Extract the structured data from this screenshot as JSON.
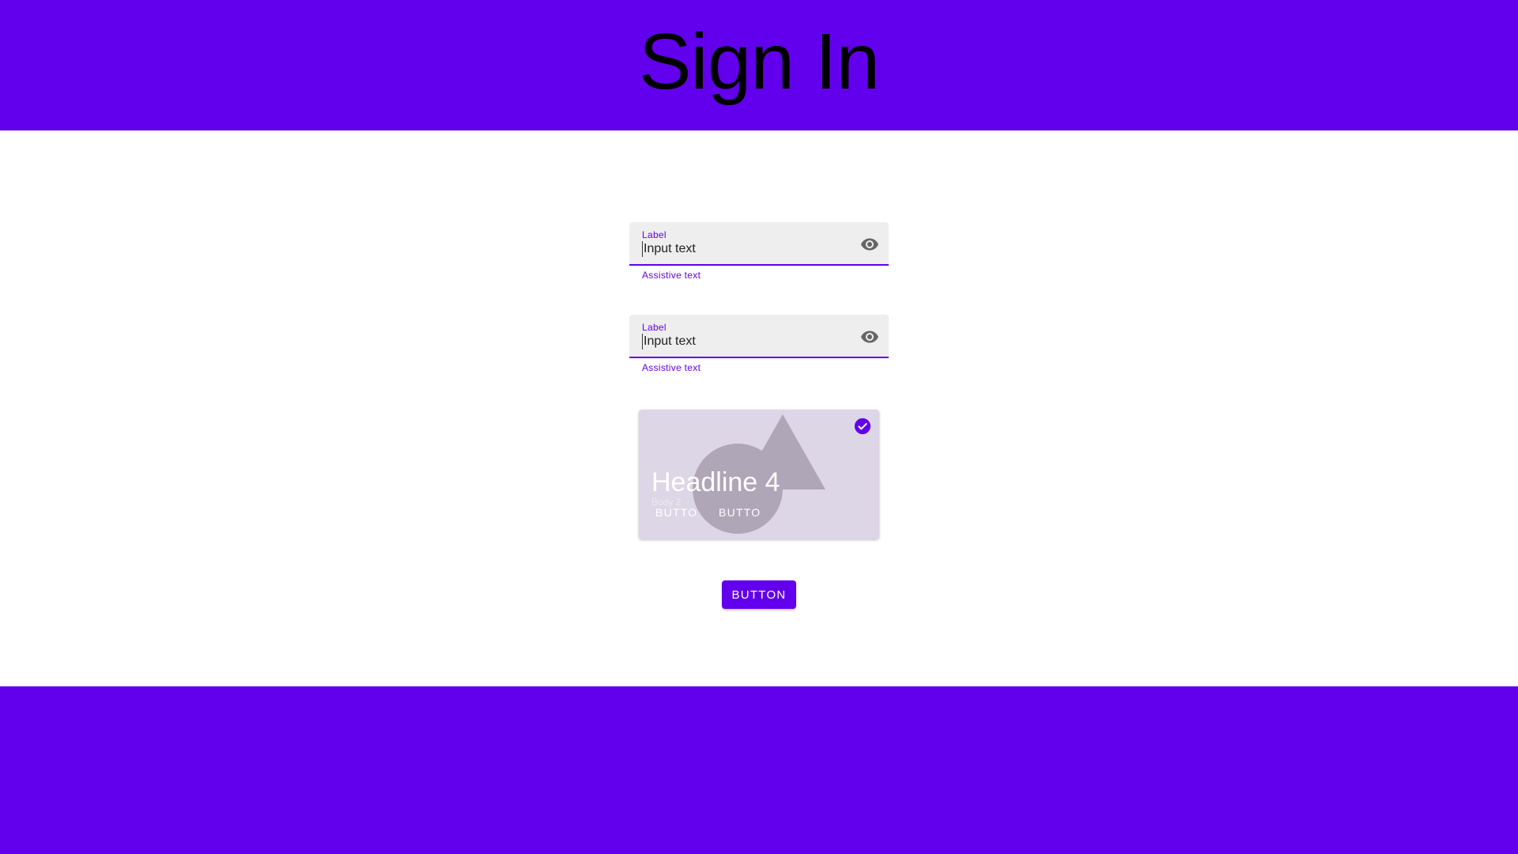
{
  "header": {
    "title": "Sign In"
  },
  "fields": [
    {
      "label": "Label",
      "value": "Input text",
      "assistive": "Assistive text",
      "icon": "eye-icon"
    },
    {
      "label": "Label",
      "value": "Input text",
      "assistive": "Assistive text",
      "icon": "eye-icon"
    }
  ],
  "card": {
    "headline": "Headline 4",
    "body": "Body 2",
    "button_1": "BUTTO",
    "button_2": "BUTTO",
    "selected": true,
    "icon": "check-circle-icon"
  },
  "primary_button": {
    "label": "BUTTON"
  },
  "colors": {
    "primary": "#6200ee",
    "field_bg": "#eeeeee",
    "card_bg": "#ddd6e6",
    "title_text": "#000000"
  }
}
